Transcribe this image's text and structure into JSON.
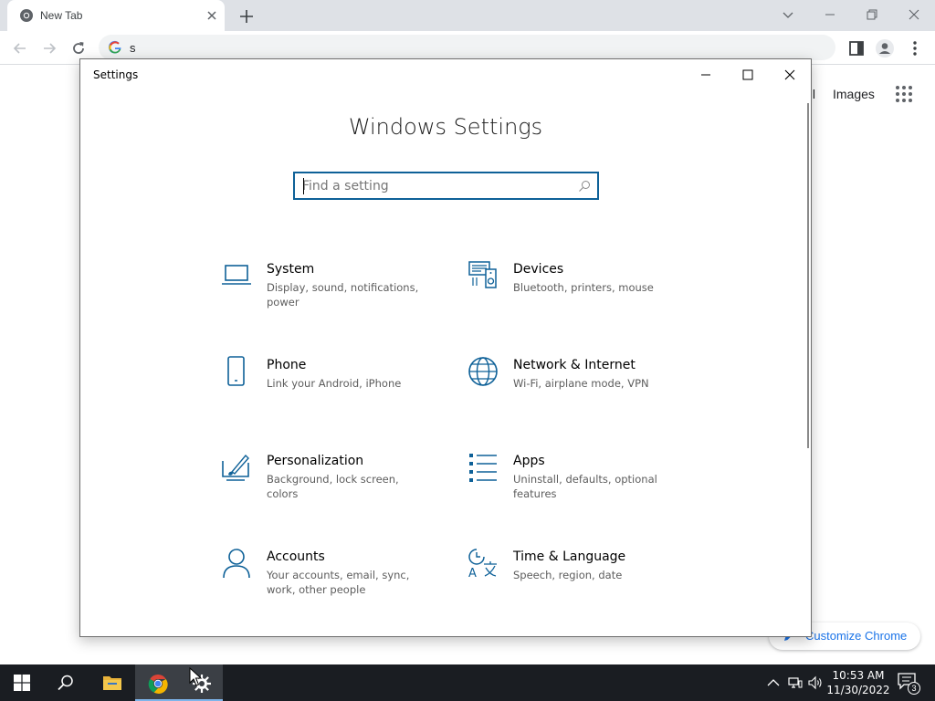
{
  "browser": {
    "tab_title": "New Tab",
    "omnibox_text": "s",
    "header_links": {
      "gmail_partial": "ail",
      "images": "Images"
    },
    "customize_label": "Customize Chrome"
  },
  "settings": {
    "window_title": "Settings",
    "heading": "Windows Settings",
    "search_placeholder": "Find a setting",
    "tiles": [
      {
        "name": "System",
        "desc": "Display, sound, notifications, power",
        "icon": "laptop-icon"
      },
      {
        "name": "Devices",
        "desc": "Bluetooth, printers, mouse",
        "icon": "devices-icon"
      },
      {
        "name": "Phone",
        "desc": "Link your Android, iPhone",
        "icon": "phone-icon"
      },
      {
        "name": "Network & Internet",
        "desc": "Wi-Fi, airplane mode, VPN",
        "icon": "globe-icon"
      },
      {
        "name": "Personalization",
        "desc": "Background, lock screen, colors",
        "icon": "paintbrush-icon"
      },
      {
        "name": "Apps",
        "desc": "Uninstall, defaults, optional features",
        "icon": "apps-list-icon"
      },
      {
        "name": "Accounts",
        "desc": "Your accounts, email, sync, work, other people",
        "icon": "person-icon"
      },
      {
        "name": "Time & Language",
        "desc": "Speech, region, date",
        "icon": "time-language-icon"
      }
    ],
    "accent_color": "#0e6198"
  },
  "taskbar": {
    "time": "10:53 AM",
    "date": "11/30/2022",
    "notification_count": "3"
  }
}
